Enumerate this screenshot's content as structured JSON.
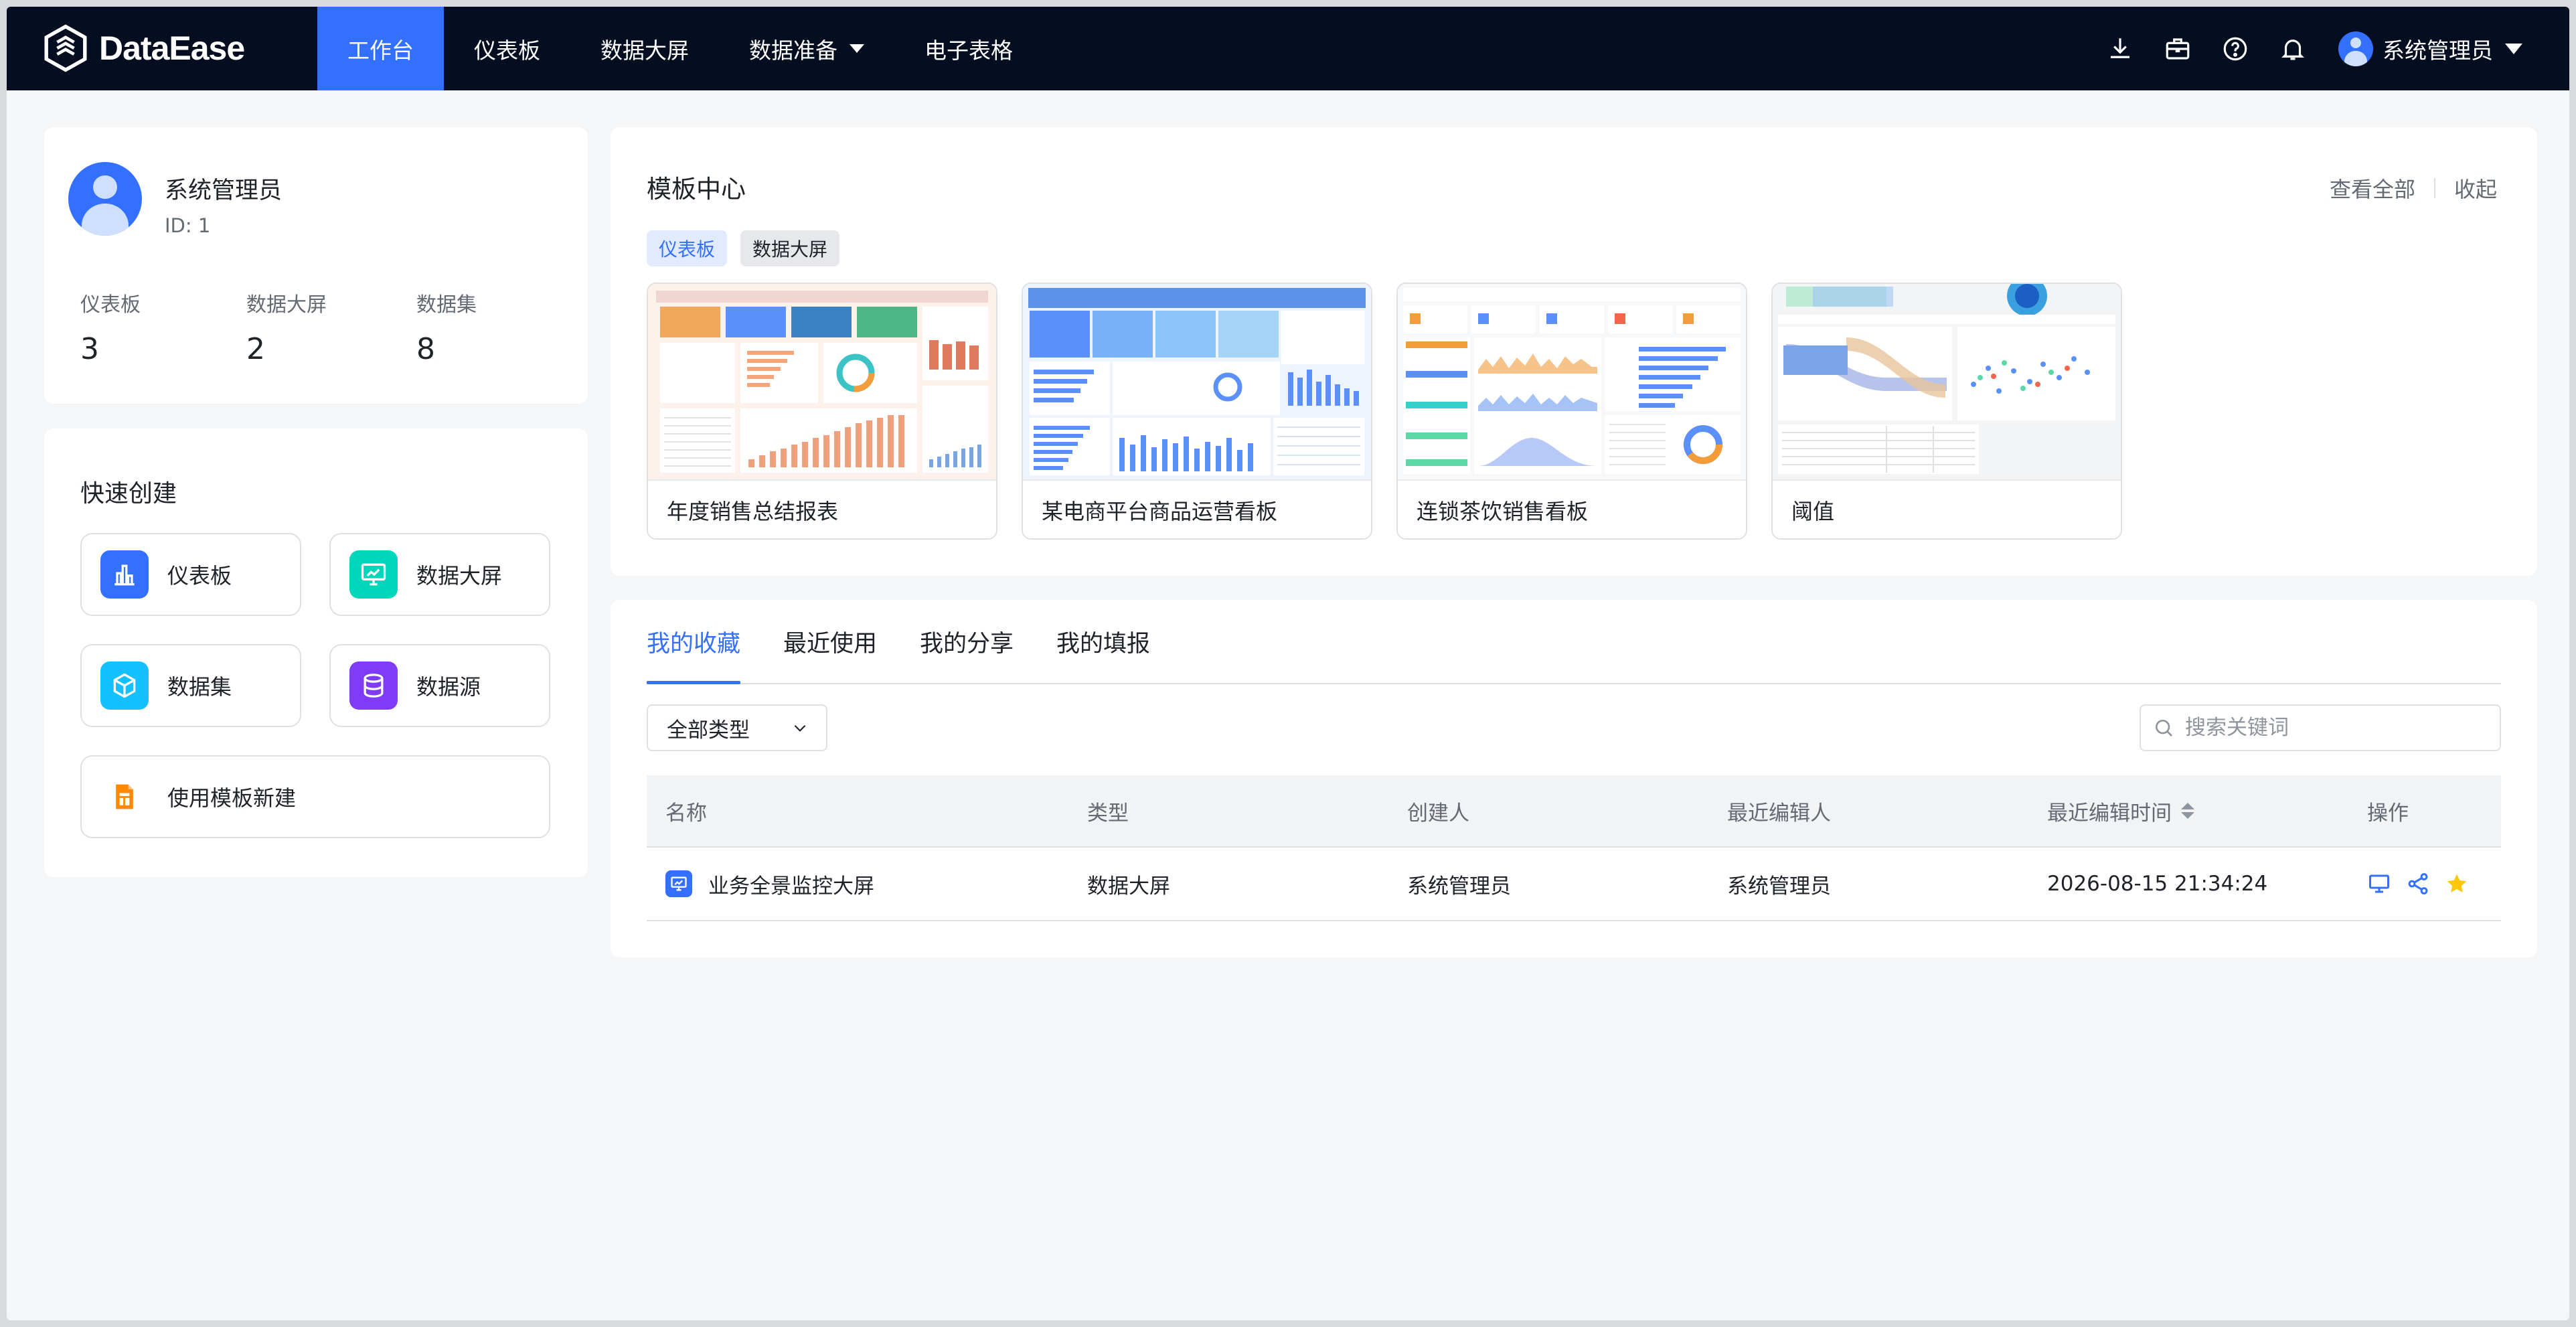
{
  "app": {
    "logo_text": "DataEase"
  },
  "nav": {
    "items": [
      {
        "label": "工作台",
        "active": true
      },
      {
        "label": "仪表板"
      },
      {
        "label": "数据大屏"
      },
      {
        "label": "数据准备"
      },
      {
        "label": "电子表格"
      }
    ],
    "user_name": "系统管理员",
    "icons": [
      "download-icon",
      "toolbox-icon",
      "help-icon",
      "bell-icon"
    ]
  },
  "profile": {
    "name": "系统管理员",
    "id_text": "ID: 1",
    "stats": [
      {
        "label": "仪表板",
        "value": "3"
      },
      {
        "label": "数据大屏",
        "value": "2"
      },
      {
        "label": "数据集",
        "value": "8"
      }
    ]
  },
  "quick_create": {
    "title": "快速创建",
    "items": [
      {
        "label": "仪表板",
        "icon": "bar-chart-icon",
        "color": "#3370ff"
      },
      {
        "label": "数据大屏",
        "icon": "monitor-chart-icon",
        "color": "#00d6b9"
      },
      {
        "label": "数据集",
        "icon": "cube-icon",
        "color": "#14c0ff"
      },
      {
        "label": "数据源",
        "icon": "database-icon",
        "color": "#7f3bf5"
      },
      {
        "label": "使用模板新建",
        "icon": "template-icon",
        "color": "#ff8800"
      }
    ]
  },
  "template_center": {
    "title": "模板中心",
    "view_all": "查看全部",
    "collapse": "收起",
    "tags": [
      {
        "label": "仪表板",
        "active": true
      },
      {
        "label": "数据大屏",
        "active": false
      }
    ],
    "templates": [
      {
        "name": "年度销售总结报表"
      },
      {
        "name": "某电商平台商品运营看板"
      },
      {
        "name": "连锁茶饮销售看板"
      },
      {
        "name": "阈值"
      }
    ]
  },
  "favorites": {
    "tabs": [
      {
        "label": "我的收藏",
        "active": true
      },
      {
        "label": "最近使用"
      },
      {
        "label": "我的分享"
      },
      {
        "label": "我的填报"
      }
    ],
    "type_filter": "全部类型",
    "search_placeholder": "搜索关键词",
    "columns": [
      "名称",
      "类型",
      "创建人",
      "最近编辑人",
      "最近编辑时间",
      "操作"
    ],
    "rows": [
      {
        "name": "业务全景监控大屏",
        "type": "数据大屏",
        "creator": "系统管理员",
        "editor": "系统管理员",
        "time": "2026-08-15 21:34:24",
        "actions": [
          "preview-icon",
          "share-icon",
          "star-icon"
        ]
      }
    ]
  },
  "colors": {
    "accent": "#3370ff",
    "nav_bg": "#050e21",
    "star": "#ffc60a"
  }
}
